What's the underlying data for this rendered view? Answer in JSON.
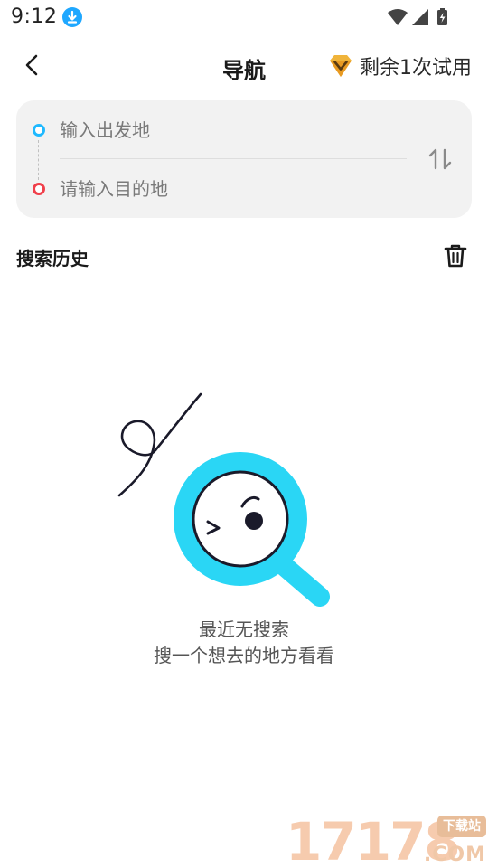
{
  "status_bar": {
    "time": "9:12",
    "icons": [
      "download-indicator-icon",
      "wifi-icon",
      "cell-signal-icon",
      "battery-charging-icon"
    ]
  },
  "header": {
    "back_icon": "chevron-left-icon",
    "title": "导航",
    "trial_icon": "vip-gem-icon",
    "trial_label": "剩余1次试用"
  },
  "route": {
    "start_placeholder": "输入出发地",
    "end_placeholder": "请输入目的地",
    "start_value": "",
    "end_value": "",
    "swap_icon": "swap-vertical-icon"
  },
  "history": {
    "title": "搜索历史",
    "delete_icon": "trash-icon"
  },
  "empty_state": {
    "illustration": "magnifier-face-icon",
    "title": "最近无搜索",
    "subtitle": "搜一个想去的地方看看"
  },
  "watermark": {
    "number": "17178",
    "badge": "下载站",
    "suffix": ".COM"
  },
  "colors": {
    "accent_cyan": "#2ad6f5",
    "start_dot": "#1fb9ff",
    "end_dot": "#f0404b",
    "card_bg": "#f2f2f2",
    "vip_gold": "#f0b43a"
  }
}
